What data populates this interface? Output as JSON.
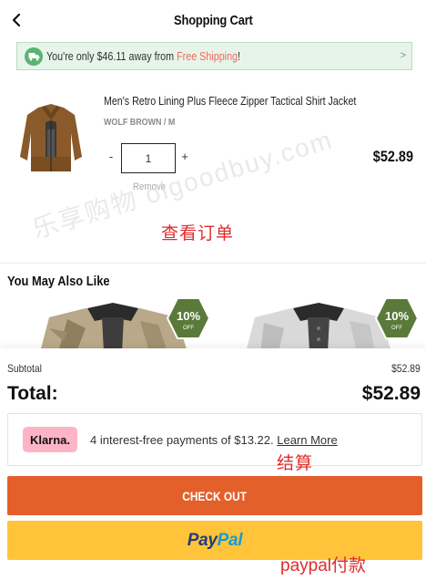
{
  "header": {
    "title": "Shopping Cart",
    "back_icon": "chevron-left-icon"
  },
  "shipping_bar": {
    "prefix": "You're only $46.11 away from ",
    "highlight": "Free Shipping",
    "suffix": "!",
    "icon": "truck-icon",
    "highlight_color": "#ef6b5a"
  },
  "cart_item": {
    "name": "Men's Retro Lining Plus Fleece Zipper Tactical Shirt Jacket",
    "variant": "WOLF BROWN / M",
    "quantity": "1",
    "minus_label": "-",
    "plus_label": "+",
    "remove_label": "Remove",
    "price": "$52.89"
  },
  "annotations": {
    "view_order": "查看订单",
    "checkout_note": "结算",
    "paypal_note": "paypal付款",
    "watermark": "乐享购物 olgoodbuy.com",
    "color": "#e02c2c"
  },
  "recommendations": {
    "title": "You May Also Like",
    "items": [
      {
        "badge_pct": "10%",
        "badge_sub": "OFF"
      },
      {
        "badge_pct": "10%",
        "badge_sub": "OFF"
      }
    ]
  },
  "summary": {
    "subtotal_label": "Subtotal",
    "subtotal_value": "$52.89",
    "total_label": "Total:",
    "total_value": "$52.89"
  },
  "klarna": {
    "logo": "Klarna.",
    "text": "4 interest-free payments of $13.22. ",
    "learn_more": "Learn More"
  },
  "buttons": {
    "checkout": "CHECK OUT",
    "paypal_part1": "Pay",
    "paypal_part2": "Pal",
    "checkout_color": "#e4602a",
    "paypal_color": "#ffc439"
  }
}
